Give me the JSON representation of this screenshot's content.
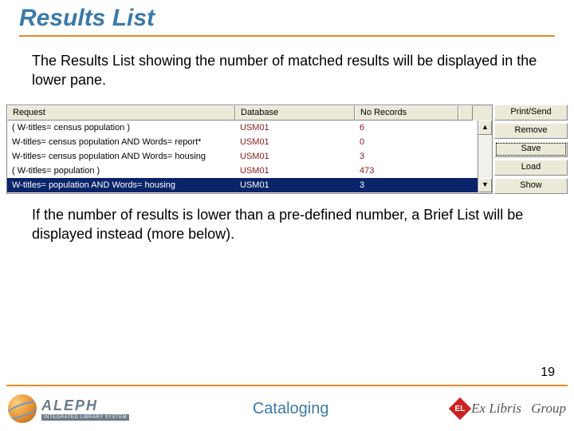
{
  "title": "Results List",
  "intro": "The Results List showing the number of matched results will be displayed in the lower pane.",
  "outro": "If the number of results is lower than a pre-defined number, a Brief List will be displayed instead (more below).",
  "columns": {
    "request": "Request",
    "database": "Database",
    "norecords": "No Records"
  },
  "rows": [
    {
      "request": "( W-titles= census population )",
      "database": "USM01",
      "norecords": "6",
      "selected": false
    },
    {
      "request": "W-titles= census population AND Words= report*",
      "database": "USM01",
      "norecords": "0",
      "selected": false
    },
    {
      "request": "W-titles= census population AND Words= housing",
      "database": "USM01",
      "norecords": "3",
      "selected": false
    },
    {
      "request": "( W-titles= population )",
      "database": "USM01",
      "norecords": "473",
      "selected": false
    },
    {
      "request": "W-titles= population AND Words= housing",
      "database": "USM01",
      "norecords": "3",
      "selected": true
    }
  ],
  "buttons": {
    "printsend": "Print/Send",
    "remove": "Remove",
    "save": "Save",
    "load": "Load",
    "show": "Show"
  },
  "page_number": "19",
  "footer": {
    "product": "ALEPH",
    "product_sub": "INTEGRATED LIBRARY SYSTEM",
    "center": "Cataloging",
    "vendor_prefix": "Ex Libris",
    "vendor_suffix": "Group",
    "vendor_badge": "EL"
  }
}
